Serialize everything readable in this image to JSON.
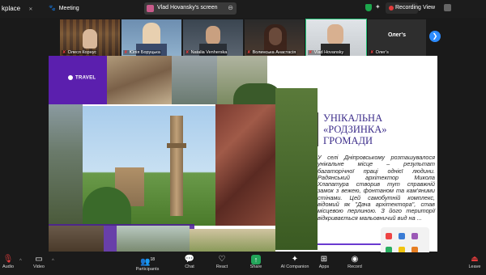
{
  "titlebar": {
    "workspace_label": "kplace",
    "meeting_label": "Meeting",
    "screen_tab_label": "Vlad Hovansky's screen",
    "recording_label": "Recording",
    "view_label": "View"
  },
  "participants": [
    {
      "name": "Олеся Корнус"
    },
    {
      "name": "Юлія Боруцька"
    },
    {
      "name": "Natalia Venherska"
    },
    {
      "name": "Волинська Анастасія"
    },
    {
      "name": "Vlad Hovansky"
    },
    {
      "name": "Олег's"
    }
  ],
  "participant_tile_title": "Олег's",
  "slide": {
    "brand": "TRAVEL",
    "heading_line1": "УНІКАЛЬНА",
    "heading_line2": "«РОДЗИНКА»",
    "heading_line3": "ГРОМАДИ",
    "body": "У селі Дніпровському розташувалося унікальне місце – результат багаторічної праці однієї людини. Радянський архітектор Микола Хлапатура створив тут справжній замок з вежею, фонтаном та кам'яними стінами. Цей самобутній комплекс, відомий як \"Дача архітектора\", став місцевою перлиною. З його території відкривається мальовничий вид на ..."
  },
  "toolbar": {
    "audio": "Audio",
    "video": "Video",
    "participants": "Participants",
    "participants_count": "18",
    "chat": "Chat",
    "react": "React",
    "share": "Share",
    "ai_companion": "AI Companion",
    "apps": "Apps",
    "record": "Record",
    "leave": "Leave"
  },
  "colors": {
    "accent_purple": "#5b1fae",
    "heading_purple": "#3b2c8a",
    "zoom_blue": "#2d8cff",
    "record_red": "#e23b3b",
    "share_green": "#23a55a"
  }
}
